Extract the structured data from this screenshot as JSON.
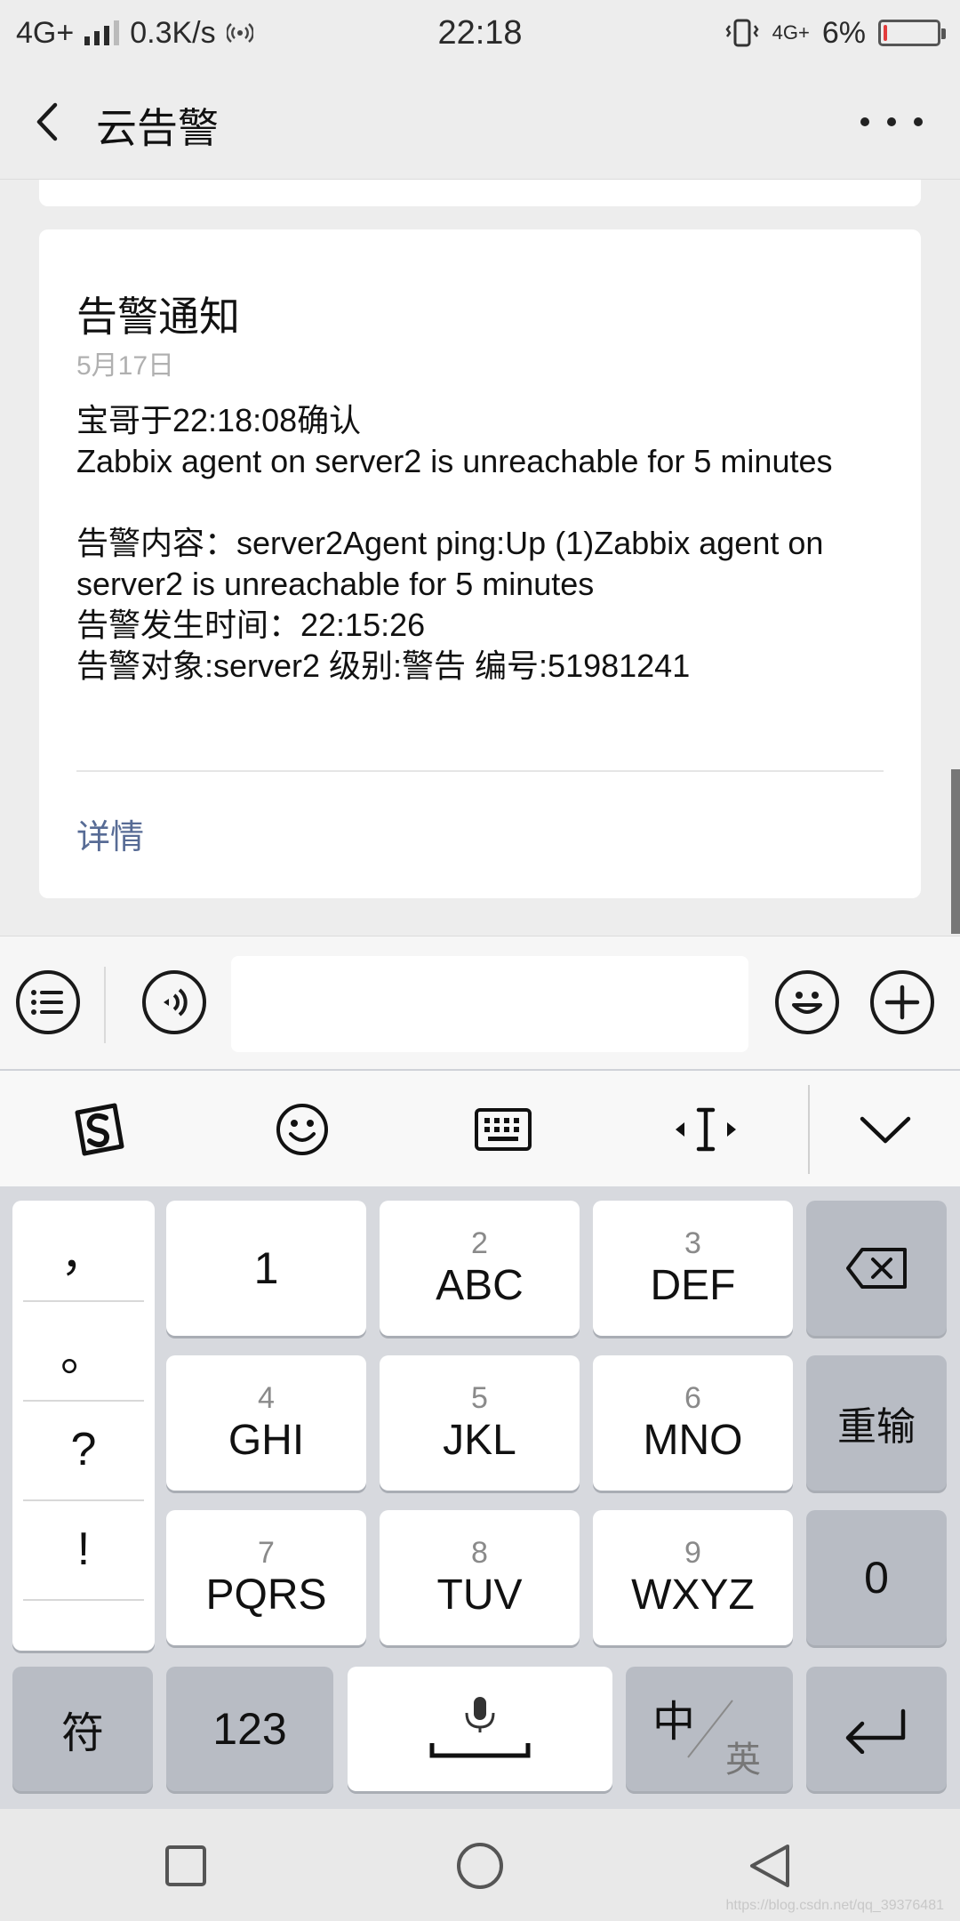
{
  "status_bar": {
    "network": "4G+",
    "speed": "0.3K/s",
    "time": "22:18",
    "network_right": "4G+",
    "battery": "6%",
    "battery_level": 0.06
  },
  "nav": {
    "title": "云告警"
  },
  "message": {
    "title": "告警通知",
    "date": "5月17日",
    "line1": "宝哥于22:18:08确认",
    "line2": "Zabbix agent on server2 is unreachable for 5 minutes",
    "content": "告警内容：server2Agent ping:Up (1)Zabbix agent on server2 is unreachable for 5 minutes",
    "occur_time": "告警发生时间：22:15:26",
    "target": "告警对象:server2 级别:警告 编号:51981241",
    "detail_link": "详情"
  },
  "keyboard": {
    "punctuation": [
      "，",
      "。",
      "?",
      "!"
    ],
    "keys": [
      {
        "num": "",
        "letters": "1"
      },
      {
        "num": "2",
        "letters": "ABC"
      },
      {
        "num": "3",
        "letters": "DEF"
      },
      {
        "num": "4",
        "letters": "GHI"
      },
      {
        "num": "5",
        "letters": "JKL"
      },
      {
        "num": "6",
        "letters": "MNO"
      },
      {
        "num": "7",
        "letters": "PQRS"
      },
      {
        "num": "8",
        "letters": "TUV"
      },
      {
        "num": "9",
        "letters": "WXYZ"
      }
    ],
    "reenter": "重输",
    "zero": "0",
    "symbols": "符",
    "numbers": "123",
    "lang_cn": "中",
    "lang_en": "英"
  },
  "watermark": "https://blog.csdn.net/qq_39376481",
  "colors": {
    "link": "#576b95",
    "background": "#ededed",
    "battery_low": "#e23b3b"
  }
}
